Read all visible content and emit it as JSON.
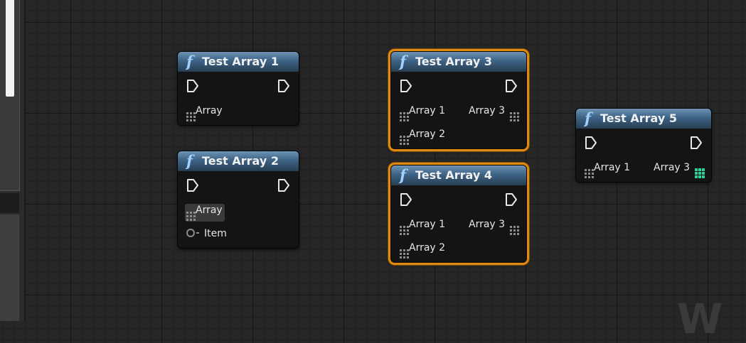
{
  "nodes": [
    {
      "title": "Test Array 1",
      "pins": {
        "in_array": "Array"
      }
    },
    {
      "title": "Test Array 2",
      "pins": {
        "in_array": "Array",
        "in_item": "Item"
      }
    },
    {
      "title": "Test Array 3",
      "pins": {
        "in_array1": "Array 1",
        "in_array2": "Array 2",
        "out_array3": "Array 3"
      }
    },
    {
      "title": "Test Array 4",
      "pins": {
        "in_array1": "Array 1",
        "in_array2": "Array 2",
        "out_array3": "Array 3"
      }
    },
    {
      "title": "Test Array 5",
      "pins": {
        "in_array1": "Array 1",
        "out_array3": "Array 3"
      }
    }
  ],
  "function_glyph": "f",
  "selected_nodes": [
    "Test Array 3",
    "Test Array 4"
  ],
  "colors": {
    "selection": "#e08a12",
    "header": "#41678a",
    "array_pin": "#8c8c8c",
    "array_pin_connected": "#2ecf98"
  }
}
